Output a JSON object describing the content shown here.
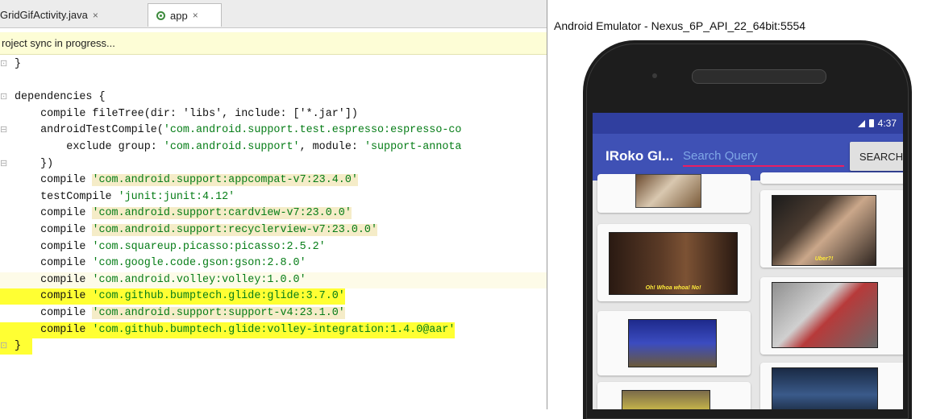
{
  "editor": {
    "tabs": [
      {
        "label": "GridGifActivity.java"
      },
      {
        "label": "app"
      }
    ],
    "close_glyph": "×",
    "notification": "roject sync in progress...",
    "lines": [
      {
        "gutter": "⊡",
        "parts": [
          {
            "t": "}",
            "c": "kw"
          }
        ]
      },
      {
        "gutter": "",
        "parts": []
      },
      {
        "gutter": "⊡",
        "parts": [
          {
            "t": "dependencies {",
            "c": "kw"
          }
        ]
      },
      {
        "gutter": "",
        "parts": [
          {
            "t": "    compile fileTree(dir: 'libs', include: ['*.jar'])",
            "c": "kw"
          }
        ]
      },
      {
        "gutter": "⊟",
        "parts": [
          {
            "t": "    androidTestCompile(",
            "c": "kw"
          },
          {
            "t": "'com.android.support.test.espresso:espresso-co",
            "c": "str"
          }
        ]
      },
      {
        "gutter": "",
        "parts": [
          {
            "t": "        exclude group: ",
            "c": "kw"
          },
          {
            "t": "'com.android.support'",
            "c": "str"
          },
          {
            "t": ", module: ",
            "c": "kw"
          },
          {
            "t": "'support-annota",
            "c": "str"
          }
        ]
      },
      {
        "gutter": "⊟",
        "parts": [
          {
            "t": "    })",
            "c": "kw"
          }
        ]
      },
      {
        "gutter": "",
        "parts": [
          {
            "t": "    compile ",
            "c": "kw"
          },
          {
            "t": "'com.android.support:appcompat-v7:23.4.0'",
            "c": "str strbg"
          }
        ]
      },
      {
        "gutter": "",
        "parts": [
          {
            "t": "    testCompile ",
            "c": "kw"
          },
          {
            "t": "'junit:junit:4.12'",
            "c": "str"
          }
        ]
      },
      {
        "gutter": "",
        "parts": [
          {
            "t": "    compile ",
            "c": "kw"
          },
          {
            "t": "'com.android.support:cardview-v7:23.0.0'",
            "c": "str strbg"
          }
        ]
      },
      {
        "gutter": "",
        "parts": [
          {
            "t": "    compile ",
            "c": "kw"
          },
          {
            "t": "'com.android.support:recyclerview-v7:23.0.0'",
            "c": "str strbg"
          }
        ]
      },
      {
        "gutter": "",
        "parts": [
          {
            "t": "    compile ",
            "c": "kw"
          },
          {
            "t": "'com.squareup.picasso:picasso:2.5.2'",
            "c": "str"
          }
        ]
      },
      {
        "gutter": "",
        "parts": [
          {
            "t": "    compile ",
            "c": "kw"
          },
          {
            "t": "'com.google.code.gson:gson:2.8.0'",
            "c": "str"
          }
        ]
      },
      {
        "gutter": "",
        "parts": [
          {
            "t": "    compile ",
            "c": "kw"
          },
          {
            "t": "'com.android.volley:volley:1.0.0'",
            "c": "str"
          }
        ],
        "hl": "half"
      },
      {
        "gutter": "",
        "parts": [
          {
            "t": "    compile ",
            "c": "kw"
          },
          {
            "t": "'com.github.bumptech.glide:glide:3.7.0'",
            "c": "str"
          }
        ],
        "hl": "mark"
      },
      {
        "gutter": "",
        "parts": [
          {
            "t": "    compile ",
            "c": "kw"
          },
          {
            "t": "'com.android.support:support-v4:23.1.0'",
            "c": "str strbg"
          }
        ]
      },
      {
        "gutter": "",
        "parts": [
          {
            "t": "    compile ",
            "c": "kw"
          },
          {
            "t": "'com.github.bumptech.glide:volley-integration:1.4.0@aar'",
            "c": "str"
          }
        ],
        "hl": "mark"
      },
      {
        "gutter": "⊡",
        "parts": [
          {
            "t": "}",
            "c": "kw"
          }
        ],
        "hl": "brace"
      }
    ]
  },
  "emulator": {
    "title": "Android Emulator - Nexus_6P_API_22_64bit:5554",
    "status_time": "4:37",
    "app_title": "IRoko GI...",
    "search_placeholder": "Search Query",
    "search_button": "SEARCH",
    "gif_captions": [
      "Uber?!",
      "Oh! Whoa whoa! No!"
    ]
  }
}
